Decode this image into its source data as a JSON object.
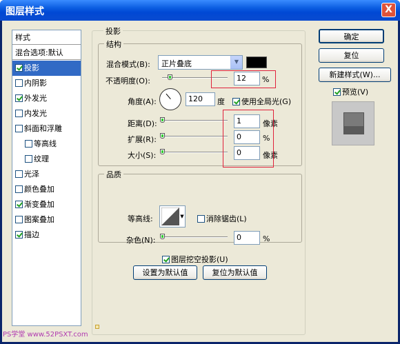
{
  "window": {
    "title": "图层样式",
    "close": "X"
  },
  "sidebar": {
    "header": "样式",
    "blend_options": "混合选项:默认",
    "items": [
      {
        "label": "投影",
        "checked": true,
        "selected": true
      },
      {
        "label": "内阴影",
        "checked": false
      },
      {
        "label": "外发光",
        "checked": true
      },
      {
        "label": "内发光",
        "checked": false
      },
      {
        "label": "斜面和浮雕",
        "checked": false
      },
      {
        "label": "等高线",
        "checked": false,
        "sub": true
      },
      {
        "label": "纹理",
        "checked": false,
        "sub": true
      },
      {
        "label": "光泽",
        "checked": false
      },
      {
        "label": "颜色叠加",
        "checked": false
      },
      {
        "label": "渐变叠加",
        "checked": true
      },
      {
        "label": "图案叠加",
        "checked": false
      },
      {
        "label": "描边",
        "checked": true
      }
    ]
  },
  "drop_shadow": {
    "title": "投影",
    "structure": {
      "title": "结构",
      "blend_mode_label": "混合模式(B):",
      "blend_mode_value": "正片叠底",
      "color": "#000000",
      "opacity_label": "不透明度(O):",
      "opacity_value": "12",
      "opacity_unit": "%",
      "angle_label": "角度(A):",
      "angle_value": "120",
      "angle_unit": "度",
      "global_light_label": "使用全局光(G)",
      "global_light_checked": true,
      "distance_label": "距离(D):",
      "distance_value": "1",
      "distance_unit": "像素",
      "spread_label": "扩展(R):",
      "spread_value": "0",
      "spread_unit": "%",
      "size_label": "大小(S):",
      "size_value": "0",
      "size_unit": "像素"
    },
    "quality": {
      "title": "品质",
      "contour_label": "等高线:",
      "antialias_label": "消除锯齿(L)",
      "antialias_checked": false,
      "noise_label": "杂色(N):",
      "noise_value": "0",
      "noise_unit": "%"
    },
    "knockout_label": "图层挖空投影(U)",
    "knockout_checked": true,
    "make_default": "设置为默认值",
    "reset_default": "复位为默认值"
  },
  "buttons": {
    "ok": "确定",
    "reset": "复位",
    "new_style": "新建样式(W)...",
    "preview_label": "预览(V)",
    "preview_checked": true
  },
  "watermark": "PS学堂 www.52PSXT.com",
  "accent": "#316ac5",
  "highlight_color": "#e0203a"
}
